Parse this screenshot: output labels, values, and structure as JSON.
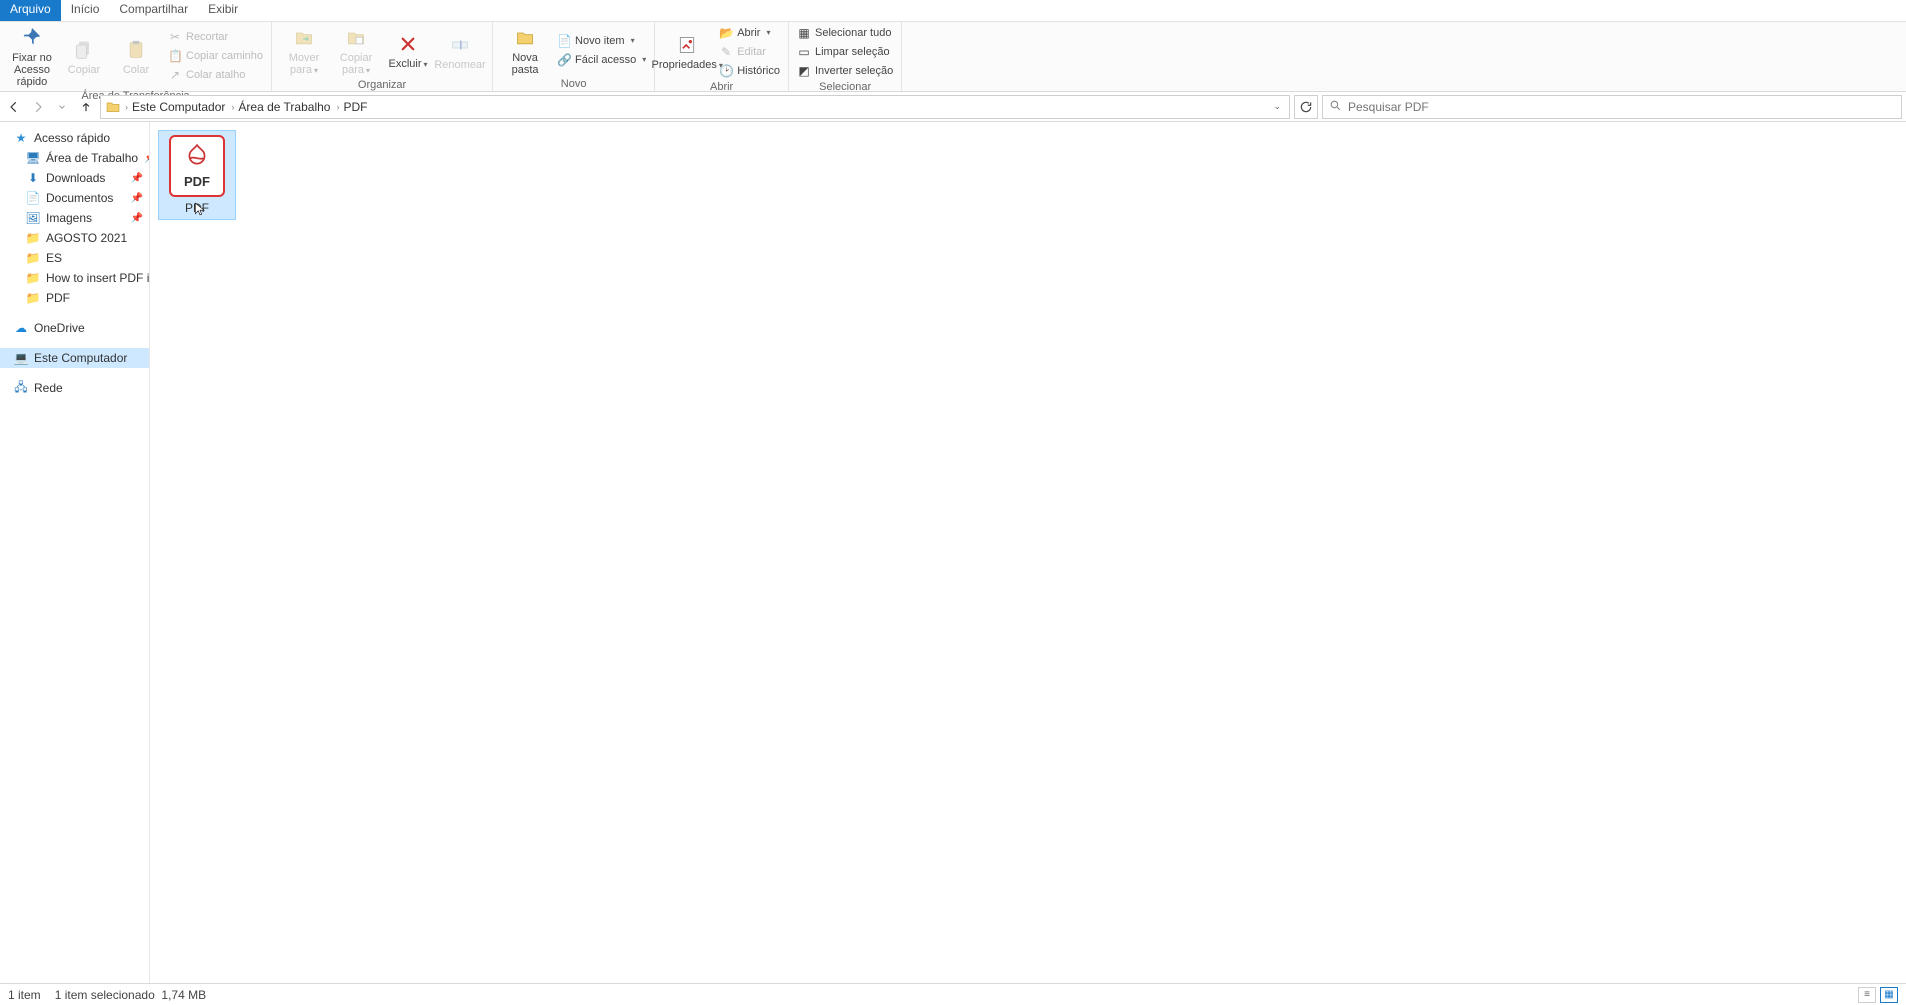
{
  "tabs": {
    "arquivo": "Arquivo",
    "inicio": "Início",
    "compartilhar": "Compartilhar",
    "exibir": "Exibir"
  },
  "ribbon": {
    "clipboard": {
      "label": "Área de Transferência",
      "fixar": "Fixar no Acesso rápido",
      "copiar": "Copiar",
      "colar": "Colar",
      "recortar": "Recortar",
      "copiar_caminho": "Copiar caminho",
      "colar_atalho": "Colar atalho"
    },
    "organizar": {
      "label": "Organizar",
      "mover_para": "Mover para",
      "copiar_para": "Copiar para",
      "excluir": "Excluir",
      "renomear": "Renomear"
    },
    "novo": {
      "label": "Novo",
      "nova_pasta": "Nova pasta",
      "novo_item": "Novo item",
      "facil_acesso": "Fácil acesso"
    },
    "abrir": {
      "label": "Abrir",
      "propriedades": "Propriedades",
      "abrir": "Abrir",
      "editar": "Editar",
      "historico": "Histórico"
    },
    "selecionar": {
      "label": "Selecionar",
      "selecionar_tudo": "Selecionar tudo",
      "limpar_selecao": "Limpar seleção",
      "inverter_selecao": "Inverter seleção"
    }
  },
  "breadcrumb": {
    "items": [
      "Este Computador",
      "Área de Trabalho",
      "PDF"
    ]
  },
  "search": {
    "placeholder": "Pesquisar PDF"
  },
  "sidebar": {
    "quick": {
      "label": "Acesso rápido"
    },
    "desktop": {
      "label": "Área de Trabalho"
    },
    "downloads": {
      "label": "Downloads"
    },
    "documentos": {
      "label": "Documentos"
    },
    "imagens": {
      "label": "Imagens"
    },
    "agosto": {
      "label": "AGOSTO 2021"
    },
    "es": {
      "label": "ES"
    },
    "howto": {
      "label": "How to insert PDF i"
    },
    "pdf": {
      "label": "PDF"
    },
    "onedrive": {
      "label": "OneDrive"
    },
    "computer": {
      "label": "Este Computador"
    },
    "rede": {
      "label": "Rede"
    }
  },
  "files": {
    "item0": {
      "name": "PDF",
      "thumb_text": "PDF"
    }
  },
  "status": {
    "count": "1 item",
    "selection": "1 item selecionado",
    "size": "1,74 MB"
  }
}
